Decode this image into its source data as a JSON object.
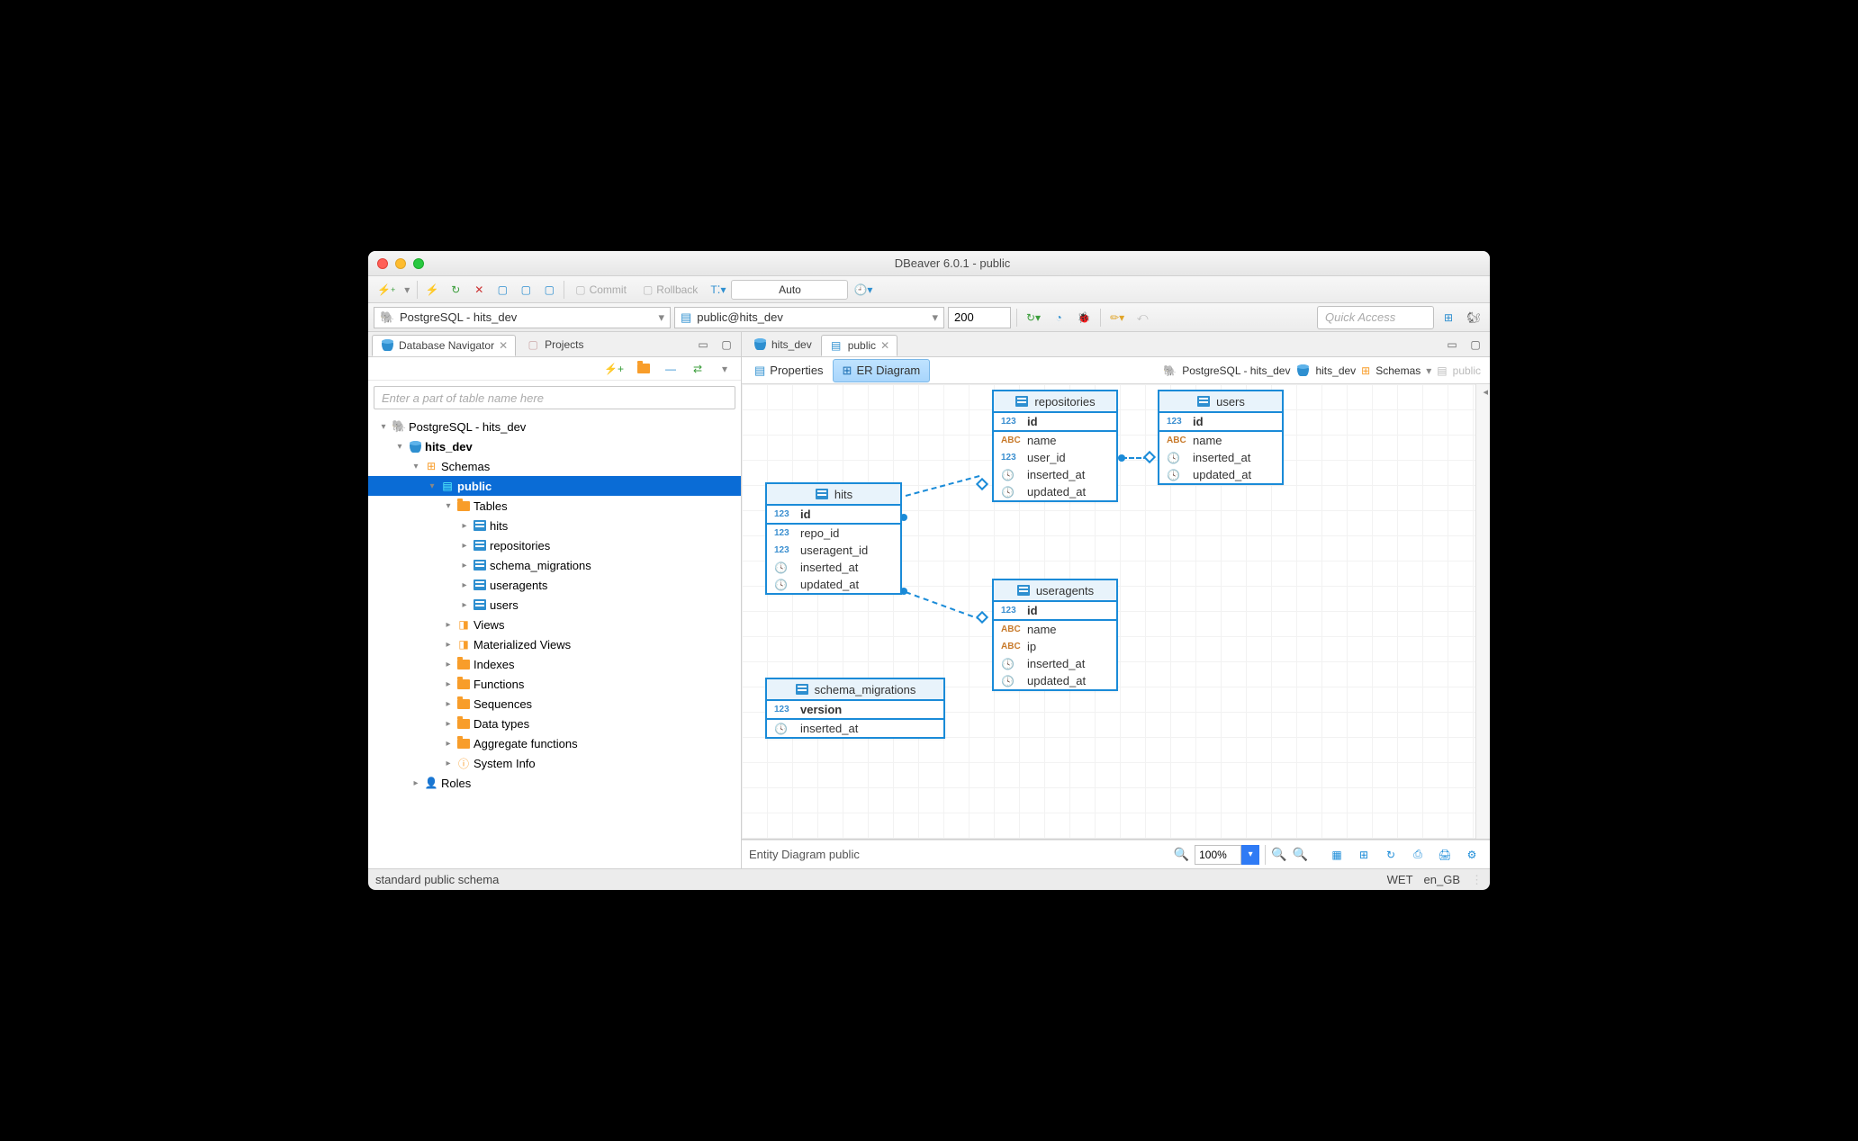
{
  "title": "DBeaver 6.0.1 - public",
  "toolbar1": {
    "commit": "Commit",
    "rollback": "Rollback",
    "mode": "Auto"
  },
  "toolbar2": {
    "connection": "PostgreSQL - hits_dev",
    "schema": "public@hits_dev",
    "limit": "200",
    "quickaccess": "Quick Access"
  },
  "sidebar": {
    "tabs": {
      "nav": "Database Navigator",
      "projects": "Projects"
    },
    "filter_placeholder": "Enter a part of table name here",
    "tree": [
      {
        "indent": 0,
        "dis": "▾",
        "icon": "pg",
        "label": "PostgreSQL - hits_dev"
      },
      {
        "indent": 1,
        "dis": "▾",
        "icon": "cyl",
        "label": "hits_dev",
        "bold": true
      },
      {
        "indent": 2,
        "dis": "▾",
        "icon": "schemas",
        "label": "Schemas"
      },
      {
        "indent": 3,
        "dis": "▾",
        "icon": "doc",
        "label": "public",
        "bold": true,
        "selected": true
      },
      {
        "indent": 4,
        "dis": "▾",
        "icon": "folder-tbl",
        "label": "Tables"
      },
      {
        "indent": 5,
        "dis": "▸",
        "icon": "tbl",
        "label": "hits"
      },
      {
        "indent": 5,
        "dis": "▸",
        "icon": "tbl",
        "label": "repositories"
      },
      {
        "indent": 5,
        "dis": "▸",
        "icon": "tbl",
        "label": "schema_migrations"
      },
      {
        "indent": 5,
        "dis": "▸",
        "icon": "tbl",
        "label": "useragents"
      },
      {
        "indent": 5,
        "dis": "▸",
        "icon": "tbl",
        "label": "users"
      },
      {
        "indent": 4,
        "dis": "▸",
        "icon": "view",
        "label": "Views"
      },
      {
        "indent": 4,
        "dis": "▸",
        "icon": "view",
        "label": "Materialized Views"
      },
      {
        "indent": 4,
        "dis": "▸",
        "icon": "folder",
        "label": "Indexes"
      },
      {
        "indent": 4,
        "dis": "▸",
        "icon": "folder",
        "label": "Functions"
      },
      {
        "indent": 4,
        "dis": "▸",
        "icon": "folder",
        "label": "Sequences"
      },
      {
        "indent": 4,
        "dis": "▸",
        "icon": "folder",
        "label": "Data types"
      },
      {
        "indent": 4,
        "dis": "▸",
        "icon": "folder",
        "label": "Aggregate functions"
      },
      {
        "indent": 4,
        "dis": "▸",
        "icon": "sys",
        "label": "System Info"
      },
      {
        "indent": 2,
        "dis": "▸",
        "icon": "roles",
        "label": "Roles"
      }
    ]
  },
  "main": {
    "tabs": [
      "hits_dev",
      "public"
    ],
    "subtabs": {
      "props": "Properties",
      "er": "ER Diagram"
    },
    "breadcrumb": {
      "conn": "PostgreSQL - hits_dev",
      "db": "hits_dev",
      "schemas": "Schemas",
      "schema": "public"
    },
    "entities": {
      "hits": {
        "title": "hits",
        "rows": [
          {
            "t": "123",
            "n": "id",
            "pk": true
          },
          {
            "t": "123",
            "n": "repo_id"
          },
          {
            "t": "123",
            "n": "useragent_id"
          },
          {
            "t": "clk",
            "n": "inserted_at"
          },
          {
            "t": "clk",
            "n": "updated_at"
          }
        ]
      },
      "repositories": {
        "title": "repositories",
        "rows": [
          {
            "t": "123",
            "n": "id",
            "pk": true
          },
          {
            "t": "ABC",
            "n": "name"
          },
          {
            "t": "123",
            "n": "user_id"
          },
          {
            "t": "clk",
            "n": "inserted_at"
          },
          {
            "t": "clk",
            "n": "updated_at"
          }
        ]
      },
      "users": {
        "title": "users",
        "rows": [
          {
            "t": "123",
            "n": "id",
            "pk": true
          },
          {
            "t": "ABC",
            "n": "name"
          },
          {
            "t": "clk",
            "n": "inserted_at"
          },
          {
            "t": "clk",
            "n": "updated_at"
          }
        ]
      },
      "useragents": {
        "title": "useragents",
        "rows": [
          {
            "t": "123",
            "n": "id",
            "pk": true
          },
          {
            "t": "ABC",
            "n": "name"
          },
          {
            "t": "ABC",
            "n": "ip"
          },
          {
            "t": "clk",
            "n": "inserted_at"
          },
          {
            "t": "clk",
            "n": "updated_at"
          }
        ]
      },
      "schema_migrations": {
        "title": "schema_migrations",
        "rows": [
          {
            "t": "123",
            "n": "version",
            "pk": true
          },
          {
            "t": "clk",
            "n": "inserted_at"
          }
        ]
      }
    },
    "erfooter": {
      "label": "Entity Diagram  public",
      "zoom": "100%"
    }
  },
  "status": {
    "msg": "standard public schema",
    "tz": "WET",
    "locale": "en_GB"
  }
}
